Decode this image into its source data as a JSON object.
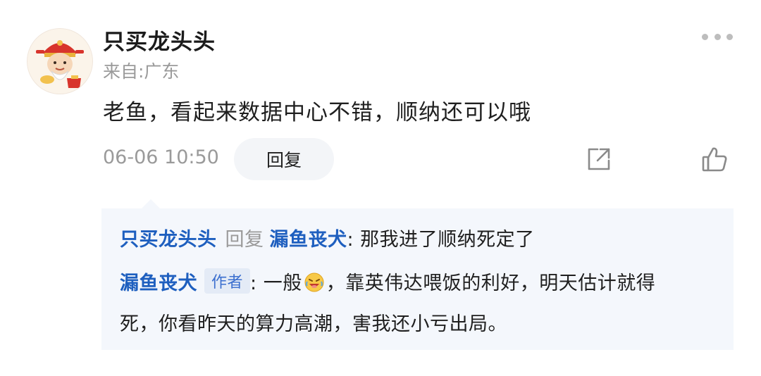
{
  "comment": {
    "username": "只买龙头头",
    "location": "来自:广东",
    "text": "老鱼，看起来数据中心不错，顺纳还可以哦",
    "time": "06-06 10:50",
    "reply_label": "回复"
  },
  "replies": [
    {
      "from": "只买龙头头",
      "reply_word": "回复",
      "to": "漏鱼丧犬",
      "text": ": 那我进了顺纳死定了"
    },
    {
      "from": "漏鱼丧犬",
      "badge": "作者",
      "text_before": ": 一般",
      "emoji": "crying-laughing-emoji",
      "text_after": "，靠英伟达喂饭的利好，明天估计就得",
      "text_line2": "死，你看昨天的算力高潮，害我还小亏出局。"
    }
  ],
  "icons": {
    "more": "more-dots-icon",
    "share": "share-icon",
    "like": "thumbs-up-icon",
    "avatar": "god-of-wealth-avatar"
  },
  "colors": {
    "name_blue": "#1e5fbf",
    "muted": "#9a9a9a",
    "reply_bg": "#f4f7fc"
  }
}
